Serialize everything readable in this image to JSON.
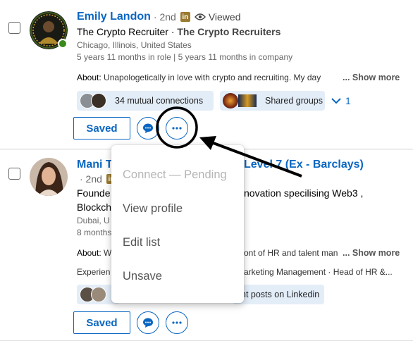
{
  "leads": [
    {
      "name": "Emily Landon",
      "degree": "· 2nd",
      "badge": "in",
      "viewed": "Viewed",
      "title": "The Crypto Recruiter ·",
      "company": "The Crypto Recruiters",
      "location": "Chicago, Illinois, United States",
      "tenure": "5 years 11 months in role | 5 years 11 months in company",
      "about_label": "About:",
      "about": "Unapologetically in love with crypto and recruiting. My day",
      "show_more": "... Show more",
      "mutual": "34 mutual connections",
      "shared_groups": "Shared groups",
      "extra_count": "1",
      "saved_label": "Saved"
    },
    {
      "name": "Mani T",
      "name_tail": "Level 7 (Ex - Barclays)",
      "degree": "· 2nd",
      "badge": "in",
      "title_start": "Founde",
      "title_end": "novation specilising Web3 ,",
      "line2": "Blockch",
      "location": "Dubai, U",
      "tenure": "8 months",
      "about_label": "About:",
      "about_start": "W",
      "about_end": "ont of HR and talent man",
      "show_more": "... Show more",
      "experience_start": "Experien",
      "experience_end": "arketing Management · Head of HR &...",
      "posts": "nt posts on Linkedin",
      "saved_label": "Saved"
    }
  ],
  "menu": {
    "items": [
      "Connect — Pending",
      "View profile",
      "Edit list",
      "Unsave"
    ]
  },
  "colors": {
    "link": "#0a66c2",
    "pill_bg": "#e3edf8",
    "presence": "#3a8a1c"
  }
}
